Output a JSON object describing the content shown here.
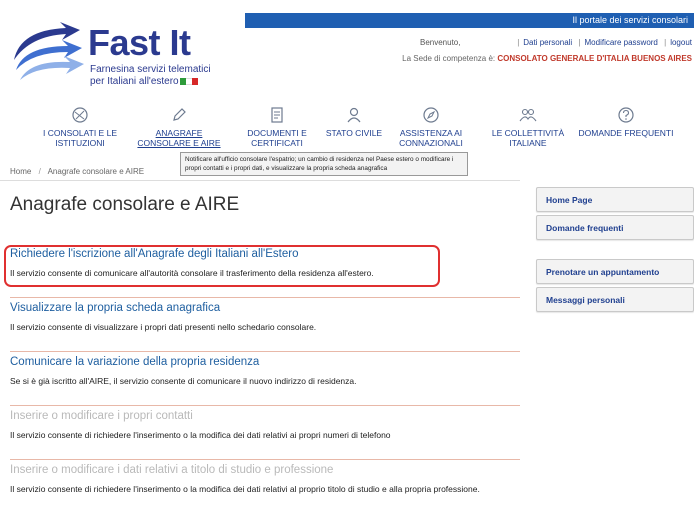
{
  "logo": {
    "title": "Fast It",
    "subtitle_line1": "Farnesina servizi telematici",
    "subtitle_line2": "per Italiani all'estero",
    "flag_colors": [
      "#2e9b3a",
      "#ffffff",
      "#d62828"
    ]
  },
  "header": {
    "portal_label": "Il portale dei servizi consolari",
    "welcome": "Benvenuto,",
    "links": [
      "Dati personali",
      "Modificare password",
      "logout"
    ],
    "sede_label": "La Sede di competenza è:",
    "sede_value": "CONSOLATO GENERALE D'ITALIA BUENOS AIRES"
  },
  "nav": {
    "items": [
      {
        "line1": "I CONSOLATI E LE",
        "line2": "ISTITUZIONI",
        "icon": "globe-icon"
      },
      {
        "line1": "ANAGRAFE",
        "line2": "CONSOLARE E AIRE",
        "icon": "pencil-icon"
      },
      {
        "line1": "DOCUMENTI E",
        "line2": "CERTIFICATI",
        "icon": "document-icon"
      },
      {
        "line1": "STATO CIVILE",
        "line2": "",
        "icon": "person-icon"
      },
      {
        "line1": "ASSISTENZA AI",
        "line2": "CONNAZIONALI",
        "icon": "compass-icon"
      },
      {
        "line1": "LE COLLETTIVITÀ",
        "line2": "ITALIANE",
        "icon": "people-icon"
      },
      {
        "line1": "DOMANDE FREQUENTI",
        "line2": "",
        "icon": "question-icon"
      }
    ],
    "tooltip": "Notificare all'ufficio consolare l'espatrio; un cambio di residenza nel Paese estero o modificare i propri contatti e i propri dati, e visualizzare la propria scheda anagrafica"
  },
  "breadcrumb": {
    "home": "Home",
    "current": "Anagrafe consolare e AIRE"
  },
  "page_title": "Anagrafe consolare e AIRE",
  "services": [
    {
      "title": "Richiedere l'iscrizione all'Anagrafe degli Italiani all'Estero",
      "desc": "Il servizio consente di comunicare all'autorità consolare il trasferimento della residenza all'estero.",
      "disabled": false
    },
    {
      "title": "Visualizzare la propria scheda anagrafica",
      "desc": "Il servizio consente di visualizzare i propri dati presenti nello schedario consolare.",
      "disabled": false
    },
    {
      "title": "Comunicare la variazione della propria residenza",
      "desc": "Se si è già iscritto all'AIRE, il servizio consente di comunicare il nuovo indirizzo di residenza.",
      "disabled": false
    },
    {
      "title": "Inserire o modificare i propri contatti",
      "desc": "Il servizio consente di richiedere l'inserimento o la modifica dei dati relativi ai propri numeri di telefono",
      "disabled": true
    },
    {
      "title": "Inserire o modificare i dati relativi a titolo di studio e professione",
      "desc": "Il servizio consente di richiedere l'inserimento o la modifica dei dati relativi al proprio titolo di studio e alla propria professione.",
      "disabled": true
    }
  ],
  "sidebar": {
    "home": "Home Page",
    "faq": "Domande frequenti",
    "appointment": "Prenotare un appuntamento",
    "messages": "Messaggi personali"
  },
  "colors": {
    "brand_blue": "#1f5fb2",
    "highlight_red": "#e03030",
    "disabled_text": "#b9b9b9"
  }
}
